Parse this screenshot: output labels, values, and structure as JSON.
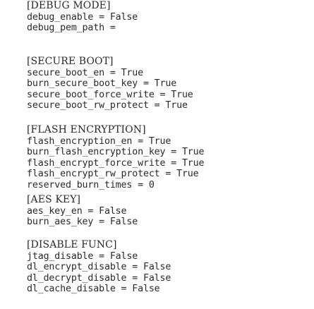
{
  "sections": [
    {
      "header": "[DEBUG MODE]",
      "lines": [
        "debug_enable = False",
        "debug_pem_path ="
      ]
    },
    {
      "header": "[SECURE BOOT]",
      "lines": [
        "secure_boot_en = True",
        "burn_secure_boot_key = True",
        "secure_boot_force_write = True",
        "secure_boot_rw_protect = True"
      ]
    },
    {
      "header": "[FLASH ENCRYPTION]",
      "lines": [
        "flash_encryption_en = True",
        "burn_flash_encryption_key = True",
        "flash_encrypt_force_write = True",
        "flash_encrypt_rw_protect = True",
        "reserved_burn_times = 0"
      ]
    },
    {
      "header": "[AES KEY]",
      "lines": [
        "aes_key_en = False",
        "burn_aes_key = False"
      ]
    },
    {
      "header": "[DISABLE FUNC]",
      "lines": [
        "jtag_disable = False",
        "dl_encrypt_disable = False",
        "dl_decrypt_disable = False",
        "dl_cache_disable = False"
      ]
    }
  ]
}
